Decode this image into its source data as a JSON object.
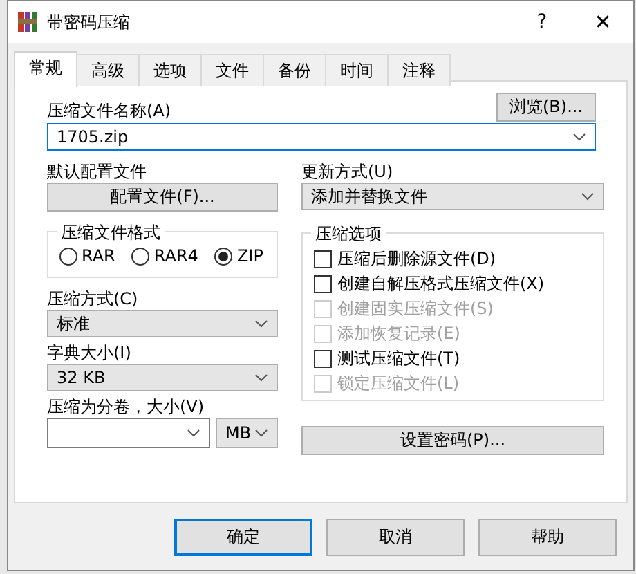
{
  "window": {
    "title": "带密码压缩",
    "help": "?",
    "close": "✕"
  },
  "tabs": [
    {
      "label": "常规",
      "selected": true
    },
    {
      "label": "高级",
      "selected": false
    },
    {
      "label": "选项",
      "selected": false
    },
    {
      "label": "文件",
      "selected": false
    },
    {
      "label": "备份",
      "selected": false
    },
    {
      "label": "时间",
      "selected": false
    },
    {
      "label": "注释",
      "selected": false
    }
  ],
  "archive_name": {
    "label": "压缩文件名称(A)",
    "value": "1705.zip",
    "browse": "浏览(B)..."
  },
  "profile": {
    "label": "默认配置文件",
    "button": "配置文件(F)..."
  },
  "update_mode": {
    "label": "更新方式(U)",
    "value": "添加并替换文件"
  },
  "format": {
    "label": "压缩文件格式",
    "options": [
      {
        "label": "RAR",
        "selected": false
      },
      {
        "label": "RAR4",
        "selected": false
      },
      {
        "label": "ZIP",
        "selected": true
      }
    ]
  },
  "method": {
    "label": "压缩方式(C)",
    "value": "标准"
  },
  "dictionary": {
    "label": "字典大小(I)",
    "value": "32 KB"
  },
  "split": {
    "label": "压缩为分卷，大小(V)",
    "unit": "MB"
  },
  "options": {
    "label": "压缩选项",
    "items": [
      {
        "label": "压缩后删除源文件(D)",
        "checked": false,
        "disabled": false
      },
      {
        "label": "创建自解压格式压缩文件(X)",
        "checked": false,
        "disabled": false
      },
      {
        "label": "创建固实压缩文件(S)",
        "checked": false,
        "disabled": true
      },
      {
        "label": "添加恢复记录(E)",
        "checked": false,
        "disabled": true
      },
      {
        "label": "测试压缩文件(T)",
        "checked": false,
        "disabled": false
      },
      {
        "label": "锁定压缩文件(L)",
        "checked": false,
        "disabled": true
      }
    ]
  },
  "password_button": "设置密码(P)...",
  "buttons": [
    {
      "label": "确定",
      "selected": true
    },
    {
      "label": "取消",
      "selected": false
    },
    {
      "label": "帮助",
      "selected": false
    }
  ]
}
